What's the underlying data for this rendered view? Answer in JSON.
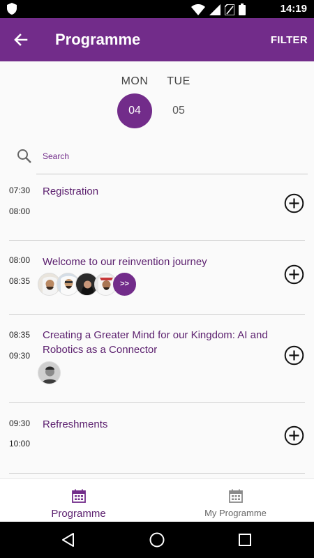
{
  "status_bar": {
    "time": "14:19"
  },
  "app_bar": {
    "title": "Programme",
    "filter_label": "FILTER"
  },
  "days": [
    {
      "name": "MON",
      "number": "04",
      "selected": true
    },
    {
      "name": "TUE",
      "number": "05",
      "selected": false
    }
  ],
  "search": {
    "label": "Search"
  },
  "sessions": [
    {
      "start": "07:30",
      "end": "08:00",
      "title": "Registration",
      "speakers": 0
    },
    {
      "start": "08:00",
      "end": "08:35",
      "title": "Welcome to our reinvention journey",
      "speakers": 4,
      "more_label": ">>"
    },
    {
      "start": "08:35",
      "end": "09:30",
      "title": "Creating a Greater Mind for our Kingdom: AI and Robotics as a Connector",
      "speakers": 1
    },
    {
      "start": "09:30",
      "end": "10:00",
      "title": "Refreshments",
      "speakers": 0
    }
  ],
  "bottom_nav": {
    "programme_label": "Programme",
    "my_programme_label": "My Programme"
  },
  "colors": {
    "primary": "#722c8a",
    "title_text": "#5b1f6e"
  },
  "icons": [
    "shield-icon",
    "wifi-icon",
    "signal-icon",
    "battery-icon",
    "back-arrow-icon",
    "search-icon",
    "add-circle-icon",
    "calendar-icon",
    "back-triangle-icon",
    "home-circle-icon",
    "recents-square-icon"
  ]
}
